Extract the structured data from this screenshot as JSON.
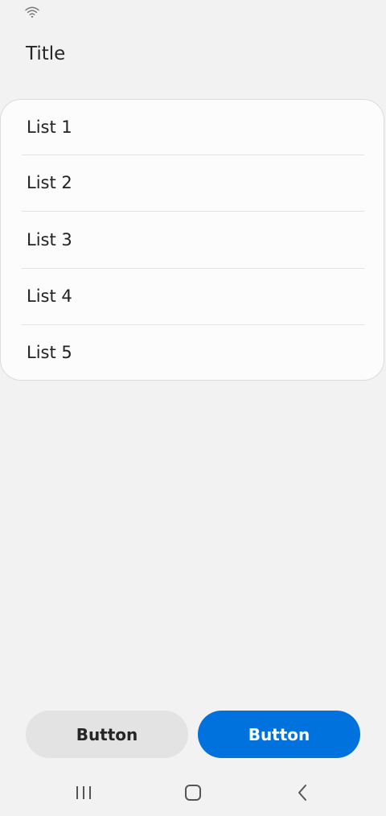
{
  "status_bar": {
    "wifi_icon": "wifi-icon"
  },
  "header": {
    "title": "Title"
  },
  "list": {
    "items": [
      {
        "label": "List 1"
      },
      {
        "label": "List 2"
      },
      {
        "label": "List 3"
      },
      {
        "label": "List 4"
      },
      {
        "label": "List 5"
      }
    ]
  },
  "buttons": {
    "secondary_label": "Button",
    "primary_label": "Button"
  },
  "nav": {
    "recents_icon": "recents-icon",
    "home_icon": "home-icon",
    "back_icon": "back-icon"
  },
  "colors": {
    "background": "#f2f2f2",
    "card": "#fcfcfc",
    "primary": "#0072de",
    "secondary": "#e3e3e3"
  }
}
